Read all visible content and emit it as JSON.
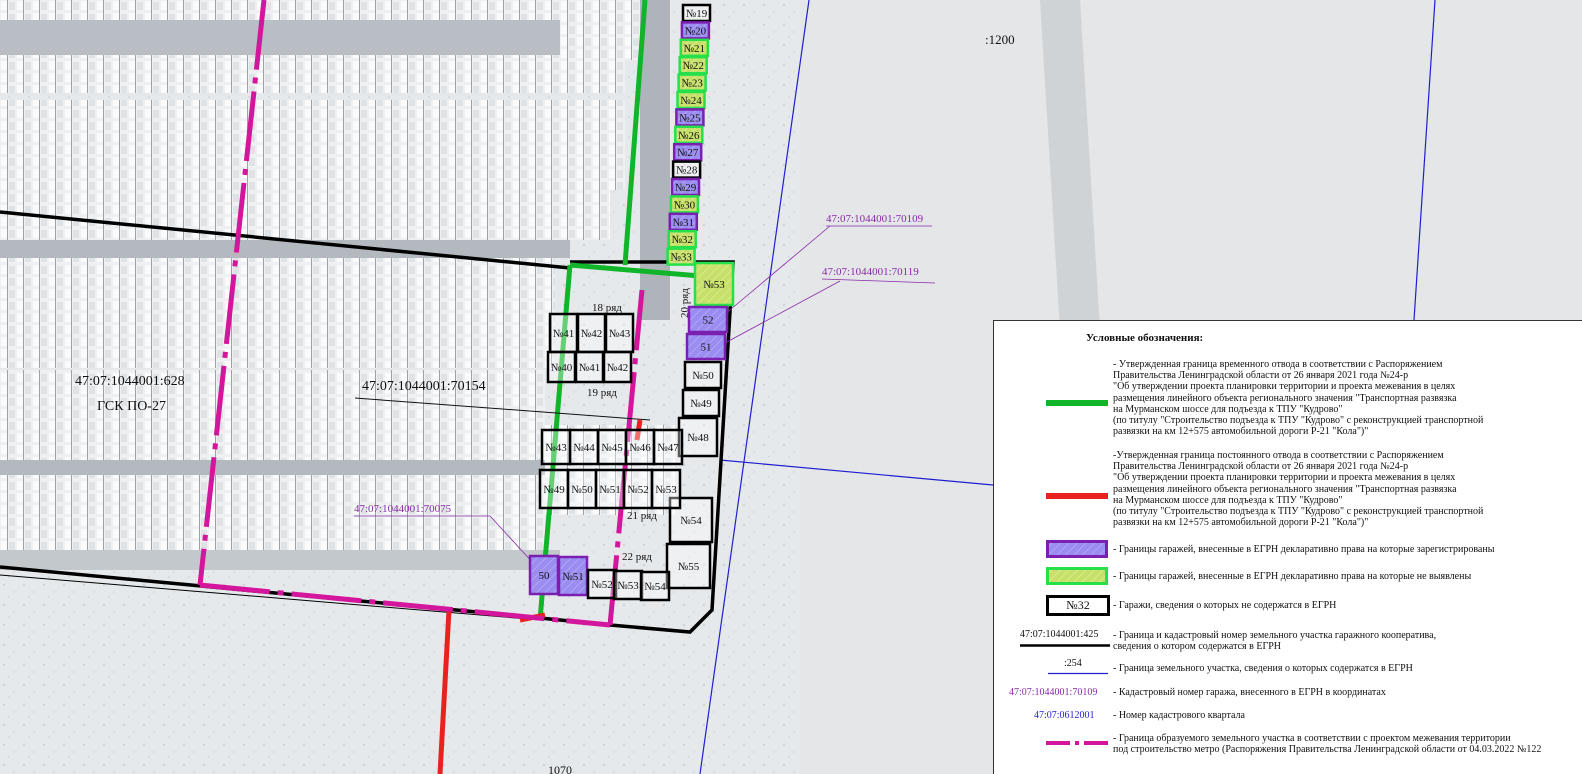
{
  "map": {
    "quarter_label": ":1200",
    "bottom_label": "1070",
    "parcel_main": "47:07:1044001:628",
    "parcel_main_name": "ГСК ПО-27",
    "parcel_70154": "47:07:1044001:70154",
    "parcel_70109": "47:07:1044001:70109",
    "parcel_70119": "47:07:1044001:70119",
    "parcel_70075": "47:07:1044001:70075",
    "row_18": "18 ряд",
    "row_19": "19 ряд",
    "row_20": "20 ряд",
    "row_21": "21 ряд",
    "row_22": "22 ряд",
    "colors": {
      "temporary_boundary": "#11b52a",
      "permanent_boundary": "#e8231f",
      "metro_boundary": "#d3169b",
      "cooperative_boundary": "#000000",
      "parcel_line": "#1f1fd0",
      "registered_fill": "#9a8cf0",
      "registered_stroke": "#7a1fb0",
      "unidentified_fill": "#c7e06a",
      "unidentified_stroke": "#25e04a",
      "cadastral_label": "#8a2aa8"
    }
  },
  "garages": {
    "column_top": [
      "№19",
      "№20",
      "№21",
      "№22",
      "№23",
      "№24",
      "№25",
      "№26",
      "№27",
      "№28",
      "№29",
      "№30",
      "№31",
      "№32",
      "№33"
    ],
    "right_block": [
      "№53",
      "52",
      "51",
      "№50",
      "№49",
      "№48",
      "№54",
      "№55"
    ],
    "row18_top": [
      "№41",
      "№42",
      "№43"
    ],
    "row18_bottom": [
      "№40",
      "№41",
      "№42"
    ],
    "row_mid_top": [
      "№43",
      "№44",
      "№45",
      "№46",
      "№47"
    ],
    "row_mid_bottom": [
      "№49",
      "№50",
      "№51",
      "№52",
      "№53"
    ],
    "row22": [
      "50",
      "№51",
      "№52",
      "№53",
      "№54"
    ]
  },
  "legend": {
    "title": "Условные обозначения:",
    "items": [
      {
        "text": "- Утвержденная граница временного отвода в соответствии с Распоряжением\nПравительства Ленинградской области от 26 января 2021 года №24-р\n\"Об утверждении проекта планировки территории и проекта межевания в целях\nразмещения линейного объекта регионального значения \"Транспортная развязка\nна Мурманском шоссе для подъезда к ТПУ \"Кудрово\"\n(по титулу \"Строительство подъезда к ТПУ \"Кудрово\" с реконструкцией транспортной\nразвязки на км 12+575 автомобильной дороги Р-21 \"Кола\")\""
      },
      {
        "text": "-Утвержденная граница постоянного отвода в соответствии с Распоряжением\nПравительства Ленинградской области от 26 января 2021 года №24-р\n\"Об утверждении проекта планировки территории и проекта межевания в целях\nразмещения линейного объекта регионального значения \"Транспортная развязка\nна Мурманском шоссе для подъезда к ТПУ \"Кудрово\"\n(по титулу \"Строительство подъезда к ТПУ \"Кудрово\" с реконструкцией транспортной\nразвязки на км 12+575 автомобильной дороги Р-21 \"Кола\")\""
      },
      {
        "text": "- Границы гаражей, внесенные в ЕГРН декларативно права на которые зарегистрированы"
      },
      {
        "text": "- Границы гаражей, внесенные в ЕГРН декларативно права на которые не выявлены"
      },
      {
        "text": "- Гаражи, сведения о которых не содержатся в ЕГРН",
        "swatch_label": "№32"
      },
      {
        "text": "- Граница и кадастровый номер земельного участка гаражного кооператива,\nсведения о котором содержатся в ЕГРН",
        "swatch_label": "47:07:1044001:425"
      },
      {
        "text": "- Граница земельного участка, сведения о которых содержатся в ЕГРН",
        "swatch_label": ":254"
      },
      {
        "text": "- Кадастровый номер гаража, внесенного в ЕГРН в координатах",
        "swatch_label": "47:07:1044001:70109"
      },
      {
        "text": "- Номер кадастрового квартала",
        "swatch_label": "47:07:0612001"
      },
      {
        "text": "- Граница образуемого земельного участка в соответствии с проектом межевания территории\nпод строительство метро (Распоряжения Правительства Ленинградской области от 04.03.2022 №122"
      }
    ]
  }
}
